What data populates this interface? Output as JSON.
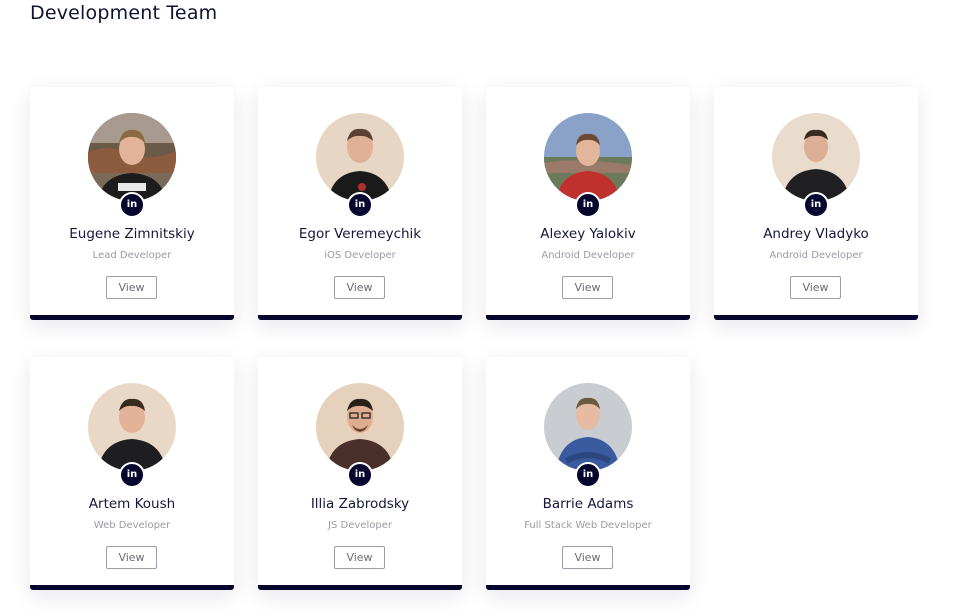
{
  "section": {
    "title": "Development Team"
  },
  "colors": {
    "accent": "#06062e",
    "card_bg": "#ffffff"
  },
  "team": [
    {
      "name": "Eugene Zimnitskiy",
      "role": "Lead Developer",
      "view_label": "View",
      "social_icon": "linkedin-icon",
      "social_label": "in"
    },
    {
      "name": "Egor Veremeychik",
      "role": "iOS Developer",
      "view_label": "View",
      "social_icon": "linkedin-icon",
      "social_label": "in"
    },
    {
      "name": "Alexey Yalokiv",
      "role": "Android Developer",
      "view_label": "View",
      "social_icon": "linkedin-icon",
      "social_label": "in"
    },
    {
      "name": "Andrey Vladyko",
      "role": "Android Developer",
      "view_label": "View",
      "social_icon": "linkedin-icon",
      "social_label": "in"
    },
    {
      "name": "Artem Koush",
      "role": "Web Developer",
      "view_label": "View",
      "social_icon": "linkedin-icon",
      "social_label": "in"
    },
    {
      "name": "Illia Zabrodsky",
      "role": "JS Developer",
      "view_label": "View",
      "social_icon": "linkedin-icon",
      "social_label": "in"
    },
    {
      "name": "Barrie Adams",
      "role": "Full Stack Web Developer",
      "view_label": "View",
      "social_icon": "linkedin-icon",
      "social_label": "in"
    }
  ]
}
